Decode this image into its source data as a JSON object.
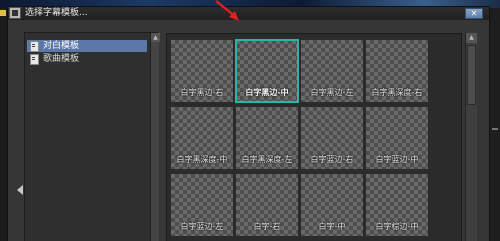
{
  "dialog": {
    "title": "选择字幕模板..."
  },
  "sidebar": {
    "items": [
      {
        "label": "对白模板",
        "selected": true
      },
      {
        "label": "歌曲模板",
        "selected": false
      }
    ]
  },
  "templates": [
    {
      "label": "白字黑边-右"
    },
    {
      "label": "白字黑边-中",
      "selected": true
    },
    {
      "label": "白字黑边-左"
    },
    {
      "label": "白字黑深度-右"
    },
    {
      "label": "白字黑深度-中"
    },
    {
      "label": "白字黑深度-左"
    },
    {
      "label": "白字蓝边-右"
    },
    {
      "label": "白字蓝边-中"
    },
    {
      "label": "白字蓝边-左"
    },
    {
      "label": "白字-右"
    },
    {
      "label": "白字-中"
    },
    {
      "label": "白字棕边-中"
    }
  ],
  "colors": {
    "selection_blue": "#5b78a8",
    "tile_highlight": "#2ab5a8",
    "pointer_arrow": "#e02020"
  }
}
